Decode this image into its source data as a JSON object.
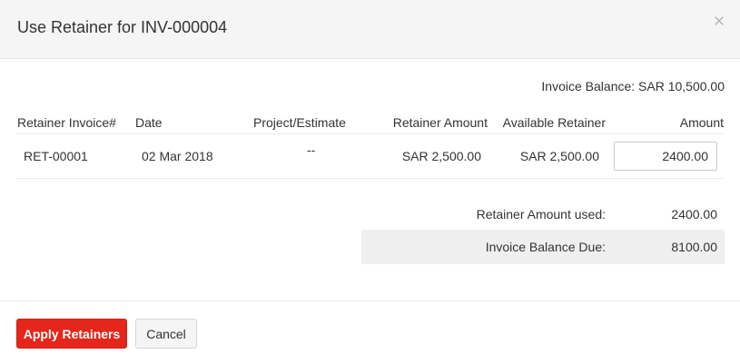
{
  "dialog": {
    "title": "Use Retainer for INV-000004",
    "close_icon": "close-icon"
  },
  "invoice_balance": "Invoice Balance: SAR 10,500.00",
  "table": {
    "headers": {
      "retainer_invoice": "Retainer Invoice#",
      "date": "Date",
      "project": "Project/Estimate",
      "retainer_amount": "Retainer Amount",
      "available_retainer": "Available Retainer",
      "amount": "Amount"
    },
    "rows": [
      {
        "retainer_invoice": "RET-00001",
        "date": "02 Mar 2018",
        "project": "--",
        "retainer_amount": "SAR 2,500.00",
        "available_retainer": "SAR 2,500.00",
        "amount": "2400.00"
      }
    ]
  },
  "summary": {
    "used_label": "Retainer Amount used:",
    "used_value": "2400.00",
    "due_label": "Invoice Balance Due:",
    "due_value": "8100.00"
  },
  "footer": {
    "apply_label": "Apply Retainers",
    "cancel_label": "Cancel"
  },
  "colors": {
    "primary": "#e4261b",
    "header_bg": "#f5f5f5",
    "summary_bg": "#efefef"
  }
}
